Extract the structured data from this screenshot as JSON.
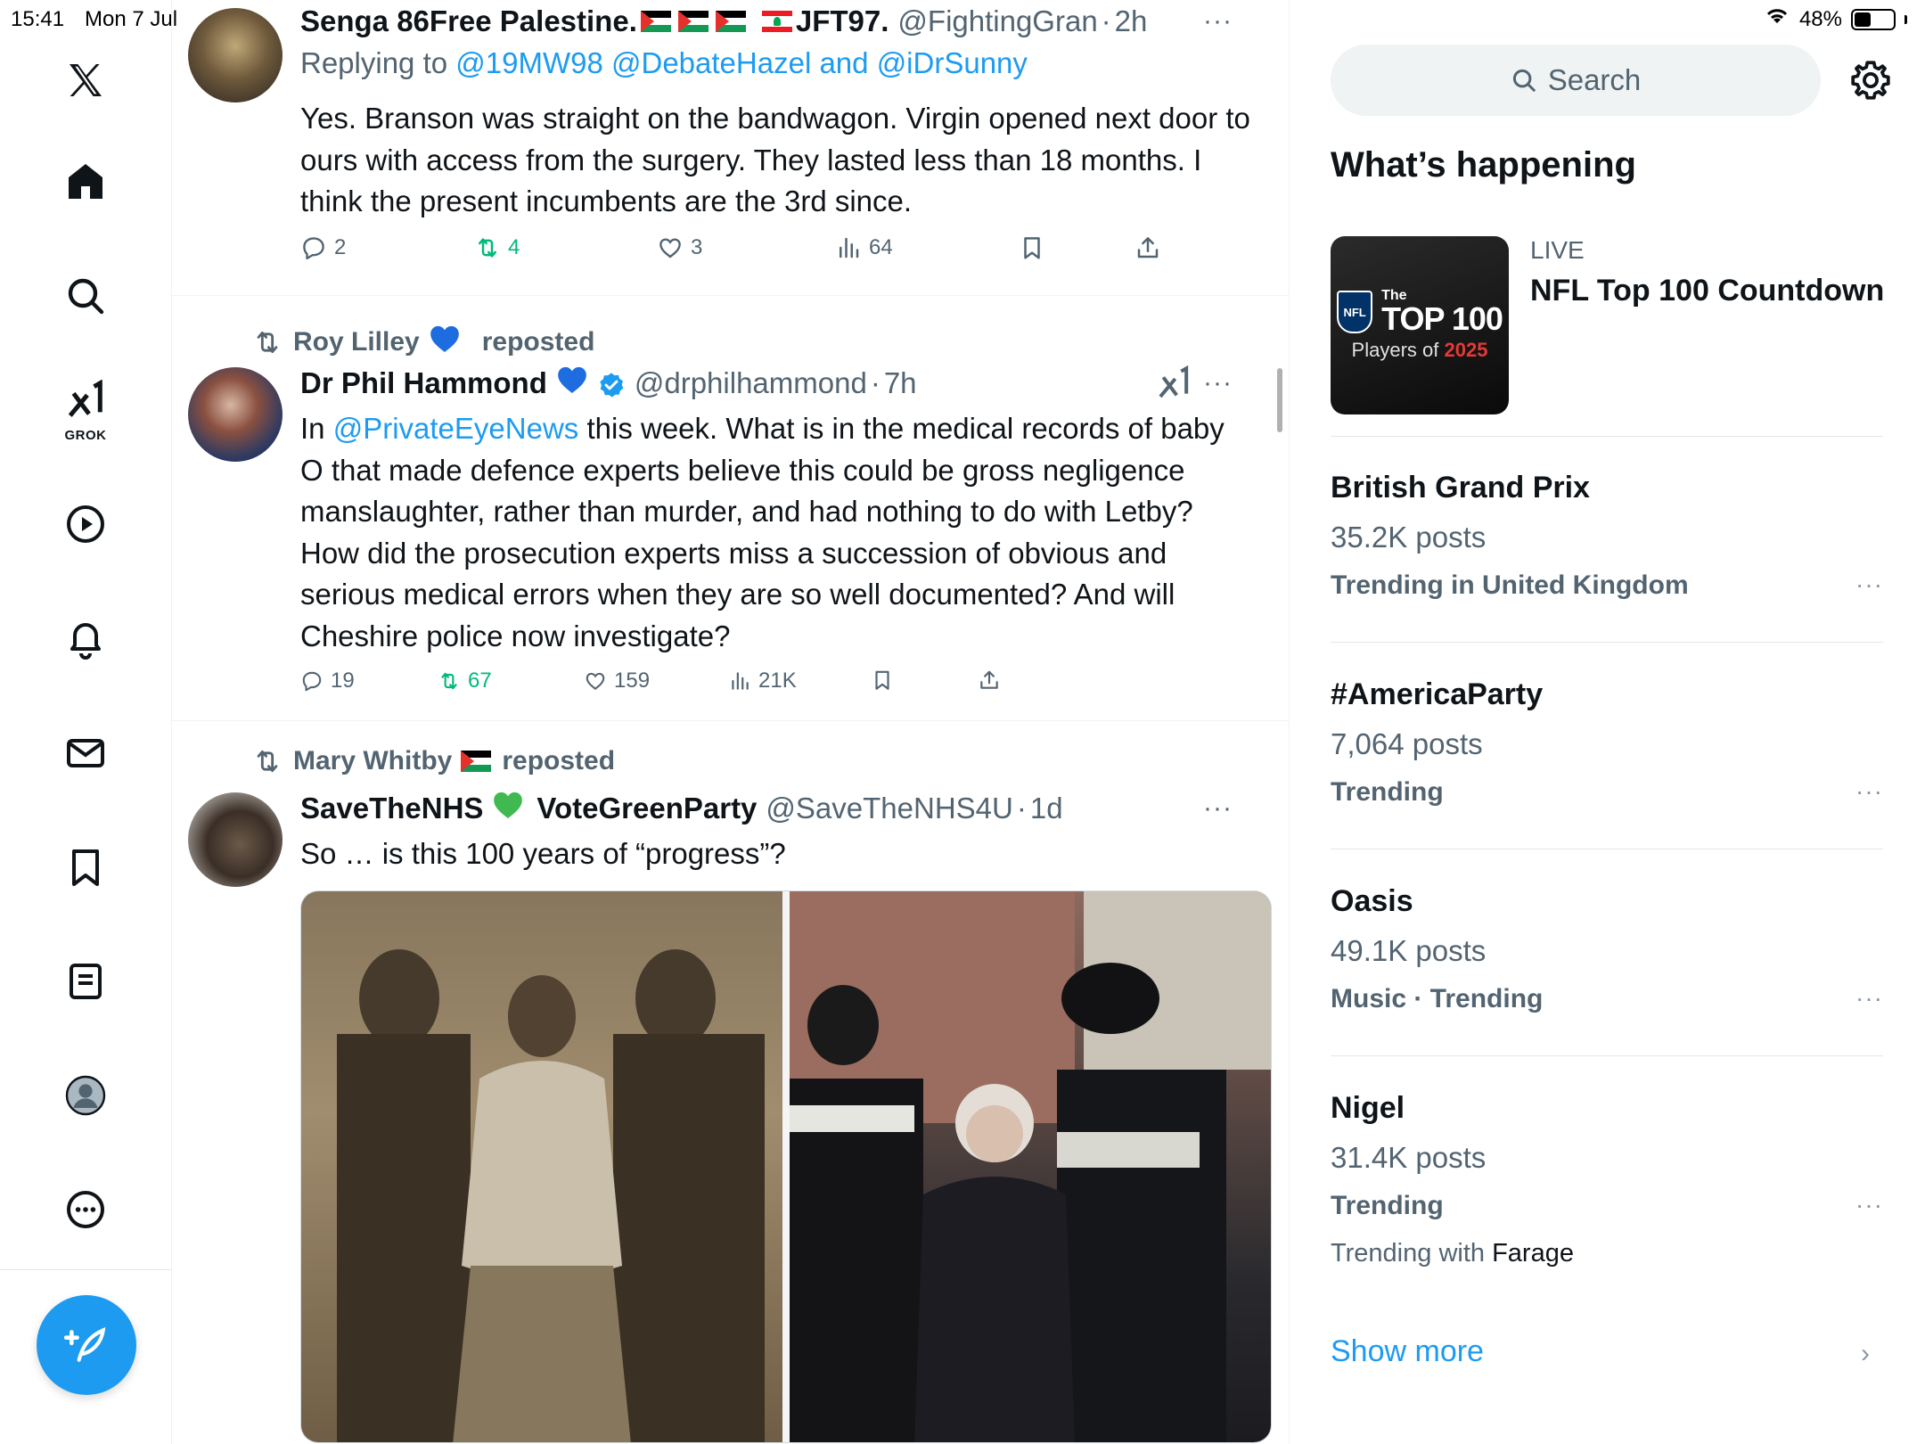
{
  "status_bar": {
    "time": "15:41",
    "date": "Mon 7 Jul",
    "battery_text": "48%",
    "battery_level": 0.48
  },
  "nav": {
    "grok_label": "GROK"
  },
  "tweets": [
    {
      "name": "Senga 86Free Palestine.",
      "name_suffix": "JFT97.",
      "handle": "@FightingGran",
      "time": "2h",
      "replying_label": "Replying to",
      "replying_to": "@19MW98 @DebateHazel",
      "replying_and": "and",
      "replying_last": "@iDrSunny",
      "text": "Yes. Branson was straight on the bandwagon. Virgin opened next door to ours with access from the surgery. They lasted less than 18 months. I think the present incumbents are the 3rd since.",
      "replies": "2",
      "reposts": "4",
      "likes": "3",
      "views": "64"
    },
    {
      "reposted_by": "Roy Lilley",
      "reposted_label": "reposted",
      "name": "Dr Phil Hammond",
      "handle": "@drphilhammond",
      "time": "7h",
      "text_prefix": "In",
      "text_mention": "@PrivateEyeNews",
      "text": "this week. What is in the medical records of baby O that made defence experts believe this could be gross negligence manslaughter, rather than murder, and had nothing to do with Letby? How did the prosecution experts miss a succession of obvious and serious medical errors when they are so well documented? And will Cheshire police now investigate?",
      "replies": "19",
      "reposts": "67",
      "likes": "159",
      "views": "21K"
    },
    {
      "reposted_by": "Mary Whitby",
      "reposted_label": "reposted",
      "name": "SaveTheNHS",
      "name_suffix": "VoteGreenParty",
      "handle": "@SaveTheNHS4U",
      "time": "1d",
      "text": "So … is this 100 years of “progress”?"
    }
  ],
  "sidebar": {
    "search_placeholder": "Search",
    "section_title": "What’s happening",
    "live": {
      "label": "LIVE",
      "title": "NFL Top 100 Countdown",
      "thumb_brand": "NFL",
      "thumb_small": "The",
      "thumb_big": "TOP 100",
      "thumb_sub": "Players of",
      "thumb_year": "2025"
    },
    "trends": [
      {
        "name": "British Grand Prix",
        "count": "35.2K posts",
        "context": "Trending in United Kingdom"
      },
      {
        "name": "#AmericaParty",
        "count": "7,064 posts",
        "context": "Trending"
      },
      {
        "name": "Oasis",
        "count": "49.1K posts",
        "context": "Music · Trending"
      },
      {
        "name": "Nigel",
        "count": "31.4K posts",
        "context": "Trending",
        "with_label": "Trending with",
        "with_value": "Farage"
      }
    ],
    "show_more": "Show more"
  },
  "colors": {
    "accent": "#1d9bf0",
    "retweet_green": "#00ba7c",
    "muted": "#536471"
  }
}
